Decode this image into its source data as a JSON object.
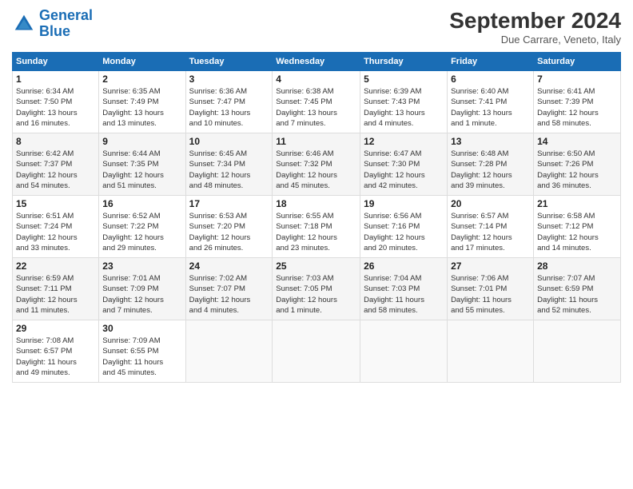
{
  "logo": {
    "line1": "General",
    "line2": "Blue"
  },
  "title": "September 2024",
  "subtitle": "Due Carrare, Veneto, Italy",
  "days_header": [
    "Sunday",
    "Monday",
    "Tuesday",
    "Wednesday",
    "Thursday",
    "Friday",
    "Saturday"
  ],
  "weeks": [
    [
      {
        "day": "1",
        "info": "Sunrise: 6:34 AM\nSunset: 7:50 PM\nDaylight: 13 hours\nand 16 minutes."
      },
      {
        "day": "2",
        "info": "Sunrise: 6:35 AM\nSunset: 7:49 PM\nDaylight: 13 hours\nand 13 minutes."
      },
      {
        "day": "3",
        "info": "Sunrise: 6:36 AM\nSunset: 7:47 PM\nDaylight: 13 hours\nand 10 minutes."
      },
      {
        "day": "4",
        "info": "Sunrise: 6:38 AM\nSunset: 7:45 PM\nDaylight: 13 hours\nand 7 minutes."
      },
      {
        "day": "5",
        "info": "Sunrise: 6:39 AM\nSunset: 7:43 PM\nDaylight: 13 hours\nand 4 minutes."
      },
      {
        "day": "6",
        "info": "Sunrise: 6:40 AM\nSunset: 7:41 PM\nDaylight: 13 hours\nand 1 minute."
      },
      {
        "day": "7",
        "info": "Sunrise: 6:41 AM\nSunset: 7:39 PM\nDaylight: 12 hours\nand 58 minutes."
      }
    ],
    [
      {
        "day": "8",
        "info": "Sunrise: 6:42 AM\nSunset: 7:37 PM\nDaylight: 12 hours\nand 54 minutes."
      },
      {
        "day": "9",
        "info": "Sunrise: 6:44 AM\nSunset: 7:35 PM\nDaylight: 12 hours\nand 51 minutes."
      },
      {
        "day": "10",
        "info": "Sunrise: 6:45 AM\nSunset: 7:34 PM\nDaylight: 12 hours\nand 48 minutes."
      },
      {
        "day": "11",
        "info": "Sunrise: 6:46 AM\nSunset: 7:32 PM\nDaylight: 12 hours\nand 45 minutes."
      },
      {
        "day": "12",
        "info": "Sunrise: 6:47 AM\nSunset: 7:30 PM\nDaylight: 12 hours\nand 42 minutes."
      },
      {
        "day": "13",
        "info": "Sunrise: 6:48 AM\nSunset: 7:28 PM\nDaylight: 12 hours\nand 39 minutes."
      },
      {
        "day": "14",
        "info": "Sunrise: 6:50 AM\nSunset: 7:26 PM\nDaylight: 12 hours\nand 36 minutes."
      }
    ],
    [
      {
        "day": "15",
        "info": "Sunrise: 6:51 AM\nSunset: 7:24 PM\nDaylight: 12 hours\nand 33 minutes."
      },
      {
        "day": "16",
        "info": "Sunrise: 6:52 AM\nSunset: 7:22 PM\nDaylight: 12 hours\nand 29 minutes."
      },
      {
        "day": "17",
        "info": "Sunrise: 6:53 AM\nSunset: 7:20 PM\nDaylight: 12 hours\nand 26 minutes."
      },
      {
        "day": "18",
        "info": "Sunrise: 6:55 AM\nSunset: 7:18 PM\nDaylight: 12 hours\nand 23 minutes."
      },
      {
        "day": "19",
        "info": "Sunrise: 6:56 AM\nSunset: 7:16 PM\nDaylight: 12 hours\nand 20 minutes."
      },
      {
        "day": "20",
        "info": "Sunrise: 6:57 AM\nSunset: 7:14 PM\nDaylight: 12 hours\nand 17 minutes."
      },
      {
        "day": "21",
        "info": "Sunrise: 6:58 AM\nSunset: 7:12 PM\nDaylight: 12 hours\nand 14 minutes."
      }
    ],
    [
      {
        "day": "22",
        "info": "Sunrise: 6:59 AM\nSunset: 7:11 PM\nDaylight: 12 hours\nand 11 minutes."
      },
      {
        "day": "23",
        "info": "Sunrise: 7:01 AM\nSunset: 7:09 PM\nDaylight: 12 hours\nand 7 minutes."
      },
      {
        "day": "24",
        "info": "Sunrise: 7:02 AM\nSunset: 7:07 PM\nDaylight: 12 hours\nand 4 minutes."
      },
      {
        "day": "25",
        "info": "Sunrise: 7:03 AM\nSunset: 7:05 PM\nDaylight: 12 hours\nand 1 minute."
      },
      {
        "day": "26",
        "info": "Sunrise: 7:04 AM\nSunset: 7:03 PM\nDaylight: 11 hours\nand 58 minutes."
      },
      {
        "day": "27",
        "info": "Sunrise: 7:06 AM\nSunset: 7:01 PM\nDaylight: 11 hours\nand 55 minutes."
      },
      {
        "day": "28",
        "info": "Sunrise: 7:07 AM\nSunset: 6:59 PM\nDaylight: 11 hours\nand 52 minutes."
      }
    ],
    [
      {
        "day": "29",
        "info": "Sunrise: 7:08 AM\nSunset: 6:57 PM\nDaylight: 11 hours\nand 49 minutes."
      },
      {
        "day": "30",
        "info": "Sunrise: 7:09 AM\nSunset: 6:55 PM\nDaylight: 11 hours\nand 45 minutes."
      },
      {
        "day": "",
        "info": ""
      },
      {
        "day": "",
        "info": ""
      },
      {
        "day": "",
        "info": ""
      },
      {
        "day": "",
        "info": ""
      },
      {
        "day": "",
        "info": ""
      }
    ]
  ]
}
